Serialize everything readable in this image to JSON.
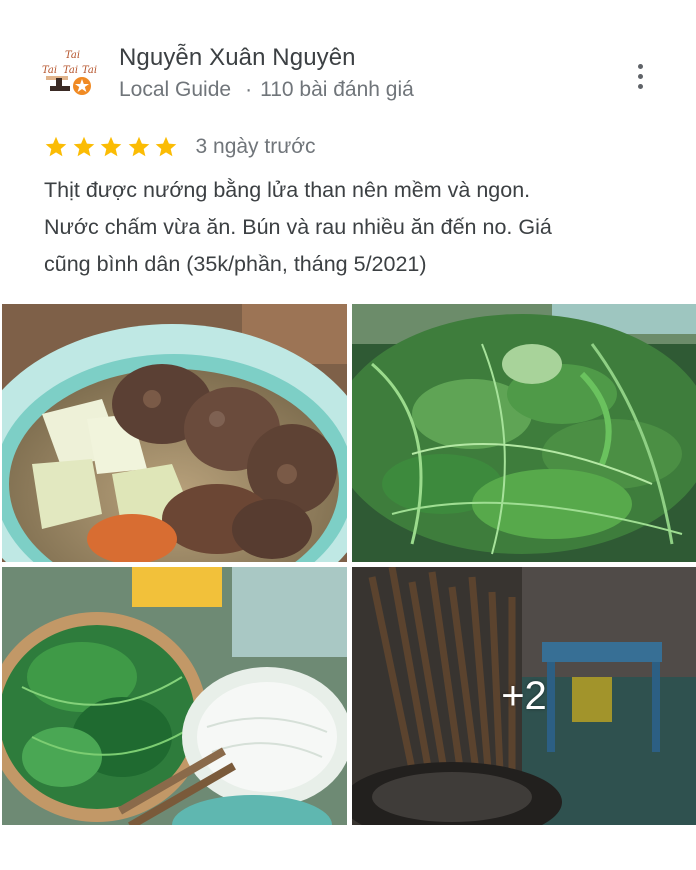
{
  "review": {
    "author": {
      "name": "Nguyễn Xuân Nguyên",
      "badge": "Local Guide",
      "separator": "·",
      "review_count": "110 bài đánh giá",
      "avatar_icon": "tai-tai-tai-logo-icon"
    },
    "rating": {
      "stars": 5,
      "max": 5,
      "star_color": "#fbbc04",
      "star_icon": "star-icon"
    },
    "date": "3 ngày trước",
    "text_lines": [
      "Thịt được nướng bằng lửa than nên mềm và ngon.",
      "Nước chấm vừa ăn. Bún và rau nhiều ăn đến no. Giá",
      "cũng bình dân (35k/phần, tháng 5/2021)"
    ],
    "more_icon": "more-vert-icon",
    "photos": {
      "count_shown": 4,
      "extra_count_label": "+2"
    }
  },
  "colors": {
    "name": "#3c4043",
    "meta": "#70757a",
    "body": "#3c4043",
    "star": "#fbbc04"
  }
}
